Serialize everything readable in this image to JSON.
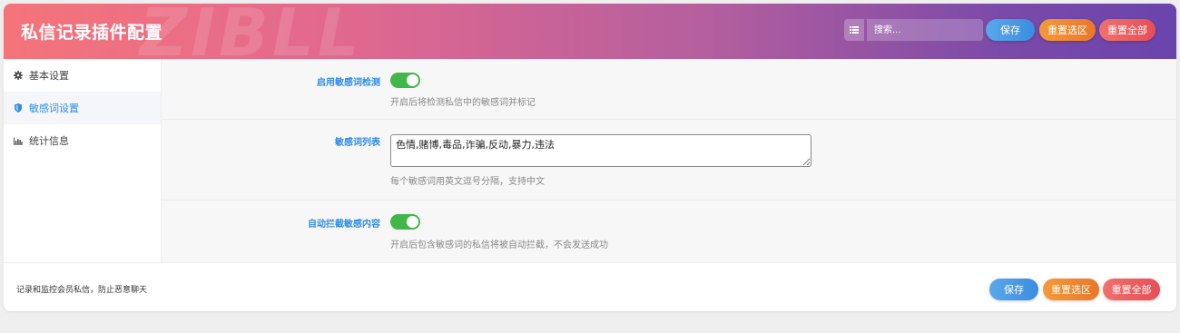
{
  "header": {
    "title": "私信记录插件配置",
    "watermark": "ZIBLL",
    "search_placeholder": "搜索...",
    "save_label": "保存",
    "reset_selection_label": "重置选区",
    "reset_all_label": "重置全部"
  },
  "sidebar": {
    "items": [
      {
        "label": "基本设置",
        "icon": "gear-icon"
      },
      {
        "label": "敏感词设置",
        "icon": "shield-icon",
        "active": true
      },
      {
        "label": "统计信息",
        "icon": "bar-chart-icon"
      }
    ]
  },
  "settings": {
    "enable_detection": {
      "label": "启用敏感词检测",
      "enabled": true,
      "description": "开启后将检测私信中的敏感词并标记"
    },
    "word_list": {
      "label": "敏感词列表",
      "value": "色情,赌博,毒品,诈骗,反动,暴力,违法",
      "description": "每个敏感词用英文逗号分隔，支持中文"
    },
    "auto_block": {
      "label": "自动拦截敏感内容",
      "enabled": true,
      "description": "开启后包含敏感词的私信将被自动拦截，不会发送成功"
    }
  },
  "footer": {
    "text": "记录和监控会员私信，防止恶意聊天",
    "save_label": "保存",
    "reset_selection_label": "重置选区",
    "reset_all_label": "重置全部"
  },
  "colors": {
    "accent": "#2f8de4",
    "toggle_on": "#43b649",
    "save": "#3b8de0",
    "reset_selection": "#e8782a",
    "reset_all": "#e64e55"
  }
}
